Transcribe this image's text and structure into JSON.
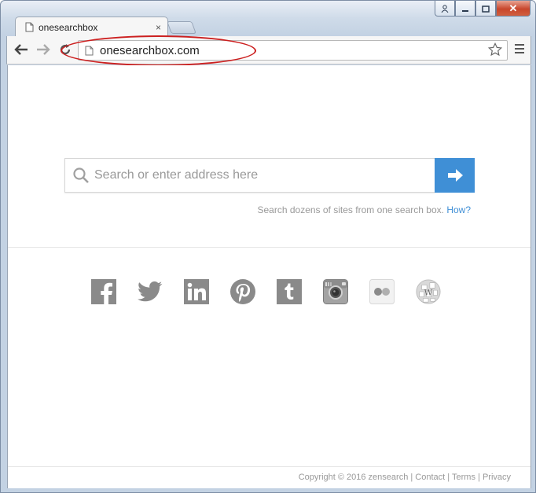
{
  "tab": {
    "title": "onesearchbox",
    "close_glyph": "×"
  },
  "window_controls": {
    "user_glyph": "👤",
    "minimize_glyph": "▭",
    "maximize_glyph": "❐",
    "close_glyph": "✕"
  },
  "address_bar": {
    "url": "onesearchbox.com"
  },
  "search": {
    "placeholder": "Search or enter address here",
    "tagline": "Search dozens of sites from one search box.",
    "how_link": "How?"
  },
  "socials": [
    "facebook-icon",
    "twitter-icon",
    "linkedin-icon",
    "pinterest-icon",
    "tumblr-icon",
    "instagram-icon",
    "flickr-icon",
    "wikipedia-icon"
  ],
  "footer": {
    "copyright": "Copyright © 2016 zensearch",
    "sep1": " | ",
    "contact": "Contact",
    "sep2": " | ",
    "terms": "Terms",
    "sep3": " | ",
    "privacy": "Privacy"
  },
  "colors": {
    "accent": "#3f8fd6",
    "icon_gray": "#8a8a8a",
    "annotation": "#cc2020"
  }
}
